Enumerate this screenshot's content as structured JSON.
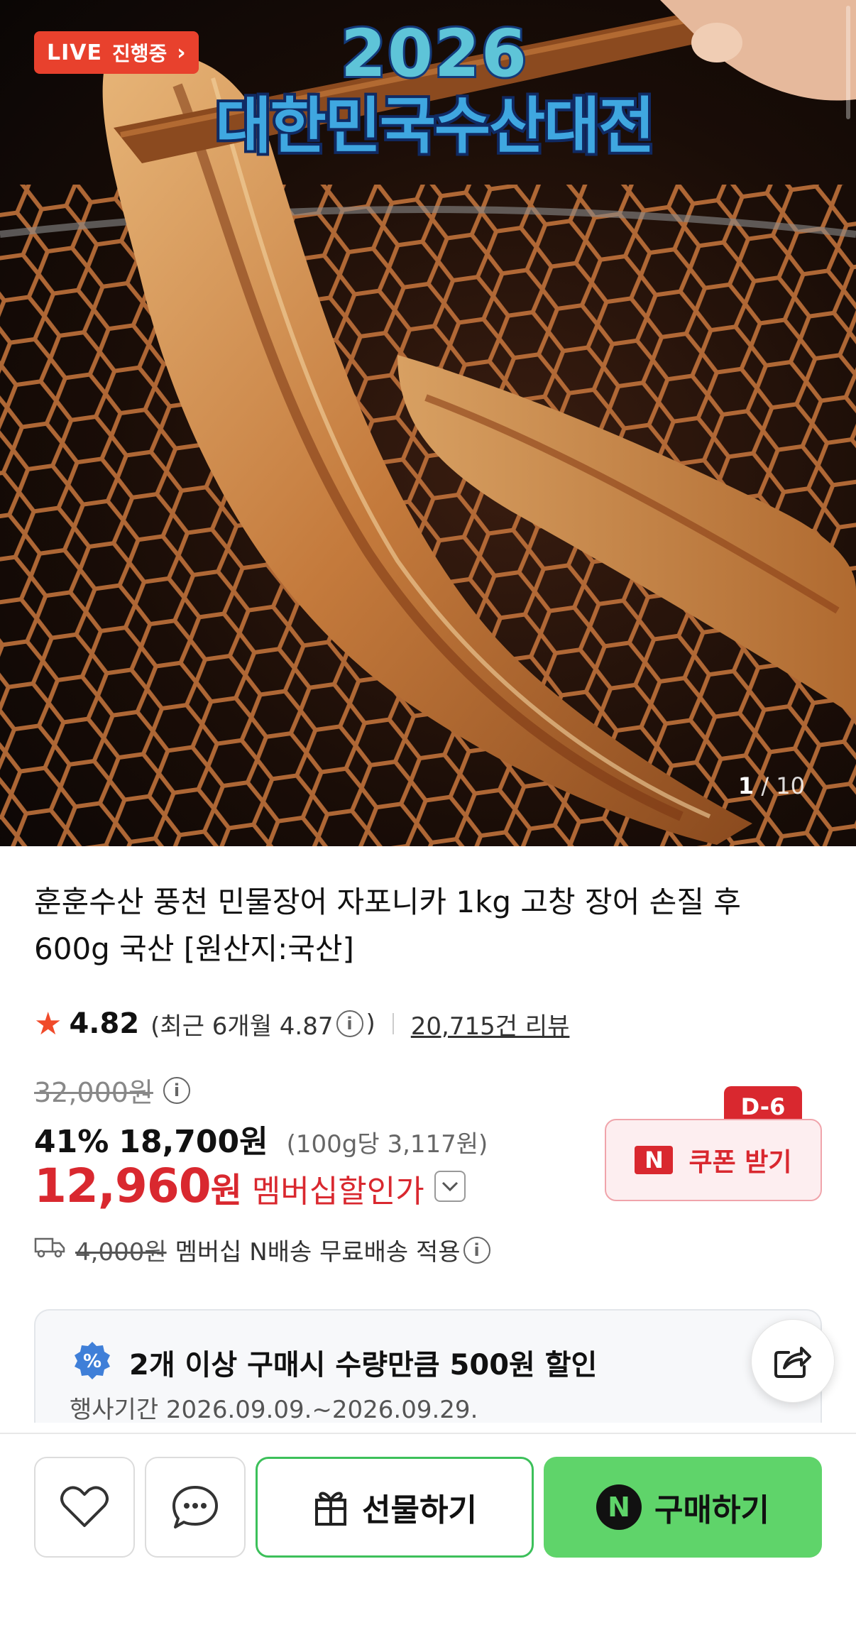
{
  "hero": {
    "live_label": "LIVE",
    "live_status": "진행중",
    "event_year": "2026",
    "event_title": "대한민국수산대전",
    "image_current": "1",
    "image_total": "/ 10"
  },
  "product": {
    "title": "훈훈수산 풍천 민물장어 자포니카 1kg 고창 장어 손질 후 600g 국산 [원산지:국산]",
    "rating": "4.82",
    "recent_rating_prefix": "(최근 6개월 4.87",
    "recent_rating_suffix": ")",
    "review_count": "20,715건 리뷰"
  },
  "pricing": {
    "original_price": "32,000원",
    "discount_rate": "41%",
    "sale_price": "18,700원",
    "unit_price": "(100g당 3,117원)",
    "member_price": "12,960",
    "member_won": "원",
    "member_label": "멤버십할인가"
  },
  "coupon": {
    "dday": "D-6",
    "n_letter": "N",
    "label": "쿠폰 받기"
  },
  "shipping": {
    "original_fee": "4,000원",
    "text": "멤버십 N배송 무료배송 적용"
  },
  "promo": {
    "title": "2개 이상 구매시 수량만큼 500원 할인",
    "period": "행사기간 2026.09.09.~2026.09.29."
  },
  "bottom_bar": {
    "gift_label": "선물하기",
    "buy_n_letter": "N",
    "buy_label": "구매하기"
  },
  "colors": {
    "accent_red": "#d9282f",
    "buy_green": "#5fd46a",
    "live_red": "#e8412d"
  },
  "icons": [
    "info-icon",
    "truck-icon",
    "percent-badge-icon",
    "share-icon",
    "wishlist-heart-icon",
    "chat-icon",
    "gift-icon",
    "chevron-down-icon",
    "star-icon"
  ]
}
